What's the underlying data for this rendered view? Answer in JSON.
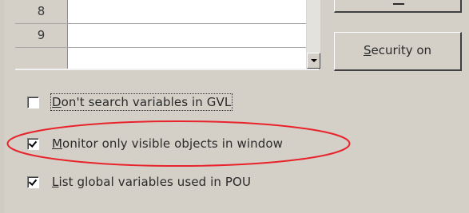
{
  "grid": {
    "rows": [
      {
        "number": "8",
        "value": ""
      },
      {
        "number": "9",
        "value": ""
      },
      {
        "number": "",
        "value": ""
      }
    ]
  },
  "buttons": {
    "top_label": "",
    "security_label_first": "S",
    "security_label_rest": "ecurity on"
  },
  "checkboxes": [
    {
      "label_first": "D",
      "label_rest": "on't search variables in GVL",
      "checked": false
    },
    {
      "label_first": "M",
      "label_rest": "onitor only visible objects in window",
      "checked": true
    },
    {
      "label_first": "L",
      "label_rest": "ist global variables used in POU",
      "checked": true
    }
  ],
  "colors": {
    "dialog_bg": "#d4d0c8",
    "annotation": "#e8232b"
  },
  "icons": [
    "chevron-down-icon",
    "checkbox-icon",
    "checkmark-icon"
  ]
}
